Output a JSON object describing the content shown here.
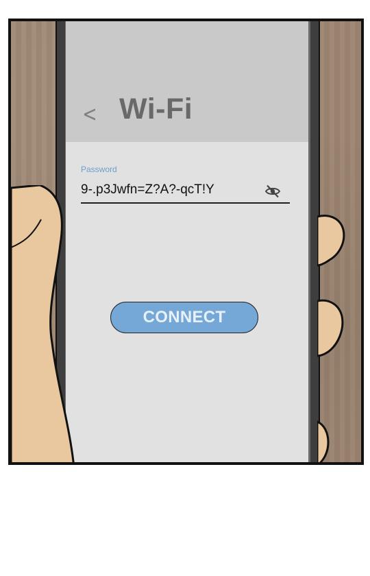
{
  "screen": {
    "title": "Wi-Fi",
    "back_icon": "<"
  },
  "password": {
    "label": "Password",
    "value": "9-.p3Jwfn=Z?A?-qcT!Y",
    "toggle_icon": "eye-slash-icon"
  },
  "actions": {
    "connect_label": "CONNECT",
    "connect_color": "#75a8d6"
  }
}
